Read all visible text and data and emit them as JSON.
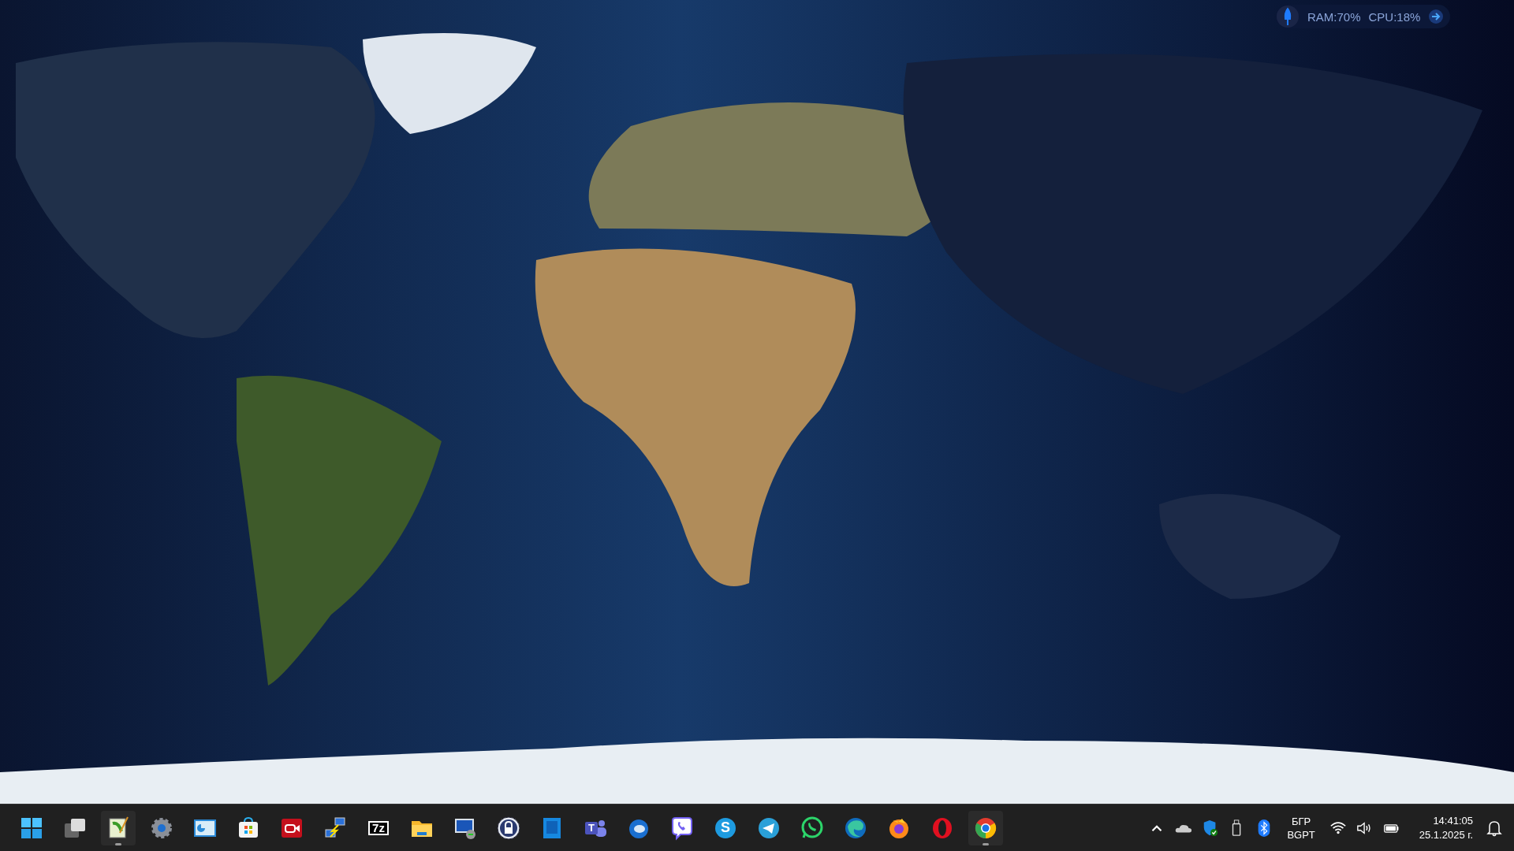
{
  "widget": {
    "ram": "RAM:70%",
    "cpu": "CPU:18%"
  },
  "taskbar": {
    "apps": [
      {
        "kind": "start",
        "running": false
      },
      {
        "kind": "taskview",
        "running": false
      },
      {
        "kind": "notepad",
        "running": true
      },
      {
        "kind": "settings",
        "running": false
      },
      {
        "kind": "chart",
        "running": false
      },
      {
        "kind": "store",
        "running": false
      },
      {
        "kind": "recorder",
        "running": false
      },
      {
        "kind": "network",
        "running": false
      },
      {
        "kind": "archive",
        "glyph": "7z",
        "running": false
      },
      {
        "kind": "folder",
        "running": false
      },
      {
        "kind": "remote",
        "running": false
      },
      {
        "kind": "lock",
        "running": false
      },
      {
        "kind": "bluebook",
        "running": false
      },
      {
        "kind": "teams",
        "glyph": "T",
        "running": false
      },
      {
        "kind": "mailbird",
        "running": false
      },
      {
        "kind": "phone",
        "running": false
      },
      {
        "kind": "skype",
        "glyph": "S",
        "running": false
      },
      {
        "kind": "plane",
        "running": false
      },
      {
        "kind": "chatphone",
        "running": false
      },
      {
        "kind": "wave",
        "running": false
      },
      {
        "kind": "fox",
        "running": false
      },
      {
        "kind": "ring",
        "running": false
      },
      {
        "kind": "chrome",
        "running": true
      }
    ],
    "tray": {
      "language": "БГР",
      "layout": "BGPT",
      "time": "14:41:05",
      "date": "25.1.2025 г."
    }
  }
}
